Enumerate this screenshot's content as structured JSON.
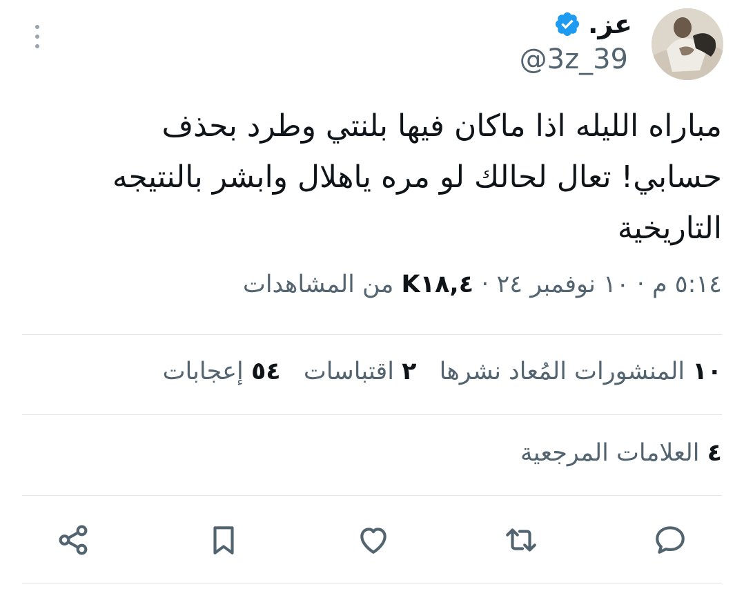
{
  "author": {
    "display_name": "عز.",
    "handle": "@3z_39",
    "verified": true
  },
  "tweet": {
    "text": "مباراه الليله اذا ماكان فيها بلنتي وطرد بحذف حسابي! تعال لحالك لو مره ياهلال وابشر بالنتيجه التاريخية"
  },
  "meta": {
    "datetime": "٥:١٤ م · ١٠ نوفمبر ٢٤",
    "separator": "·",
    "views_count": "K١٨,٤",
    "views_label": "من المشاهدات"
  },
  "stats": {
    "reposts_count": "١٠",
    "reposts_label": "المنشورات المُعاد نشرها",
    "quotes_count": "٢",
    "quotes_label": "اقتباسات",
    "likes_count": "٥٤",
    "likes_label": "إعجابات"
  },
  "bookmarks": {
    "count": "٤",
    "label": "العلامات المرجعية"
  },
  "actions": {
    "reply_icon": "speech-bubble-icon",
    "retweet_icon": "retweet-icon",
    "like_icon": "heart-icon",
    "bookmark_icon": "bookmark-icon",
    "share_icon": "share-icon"
  },
  "colors": {
    "text_primary": "#0f1419",
    "text_secondary": "#536471",
    "verified_blue": "#1d9bf0",
    "divider": "#e1e6ea"
  }
}
